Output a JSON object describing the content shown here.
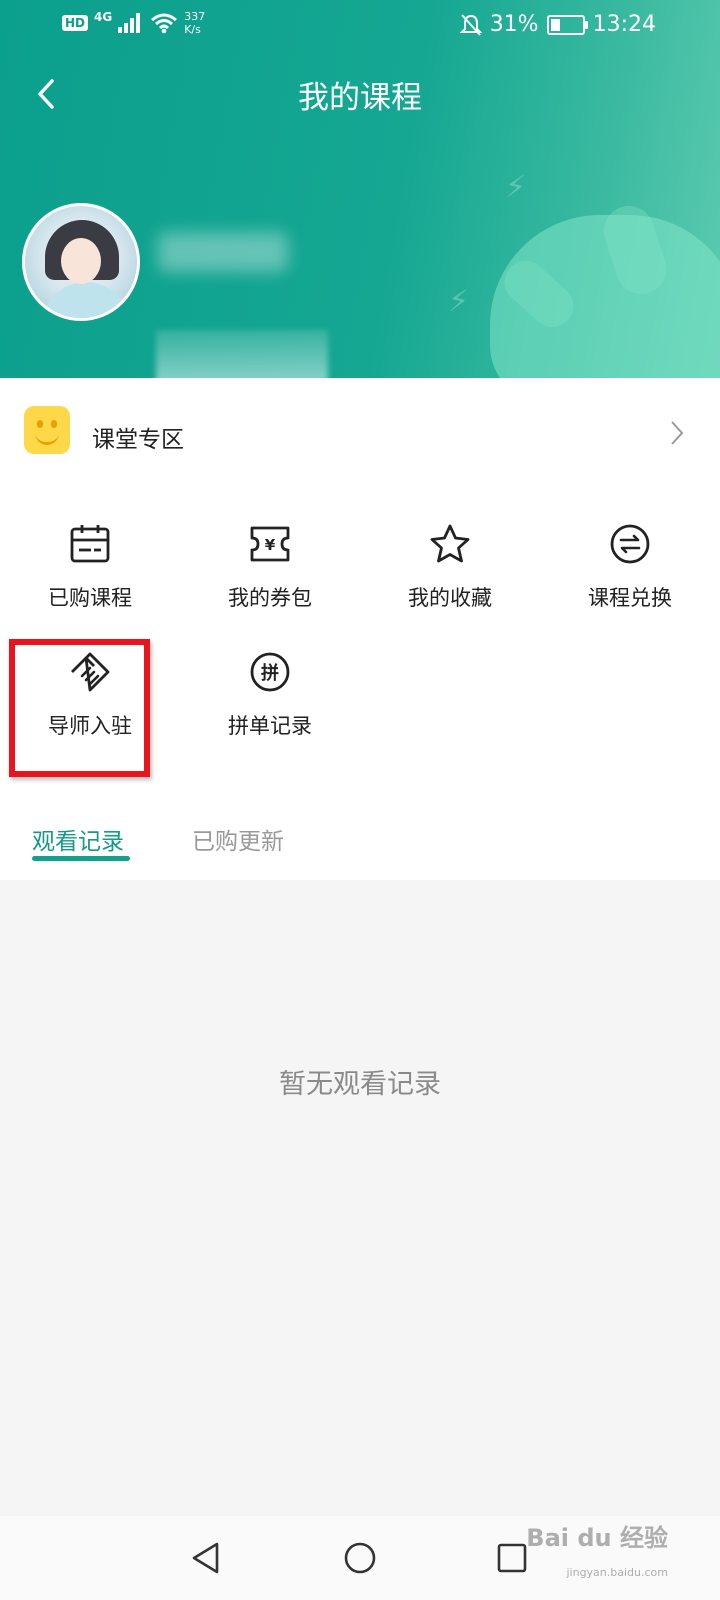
{
  "status_bar": {
    "network_badge": "HD",
    "signal_label": "4G",
    "speed_value": "337",
    "speed_unit": "K/s",
    "battery_percent": "31%",
    "battery_level": 0.31,
    "time": "13:24"
  },
  "header": {
    "title": "我的课程",
    "back_icon": "chevron-left-icon"
  },
  "classroom_zone": {
    "label": "课堂专区",
    "icon": "smiley-face-icon"
  },
  "grid": [
    {
      "label": "已购课程",
      "icon": "calendar-icon"
    },
    {
      "label": "我的券包",
      "icon": "coupon-icon"
    },
    {
      "label": "我的收藏",
      "icon": "star-icon"
    },
    {
      "label": "课程兑换",
      "icon": "exchange-icon"
    },
    {
      "label": "导师入驻",
      "icon": "handshake-icon"
    },
    {
      "label": "拼单记录",
      "icon": "group-buy-icon"
    }
  ],
  "tabs": [
    {
      "label": "观看记录",
      "active": true
    },
    {
      "label": "已购更新",
      "active": false
    }
  ],
  "empty_state": {
    "text": "暂无观看记录"
  },
  "colors": {
    "brand_teal": "#0b9f8d",
    "active_tab": "#139a88",
    "highlight_red": "#e8141e"
  },
  "watermark": {
    "text": "Bai du 经验",
    "sub": "jingyan.baidu.com"
  }
}
